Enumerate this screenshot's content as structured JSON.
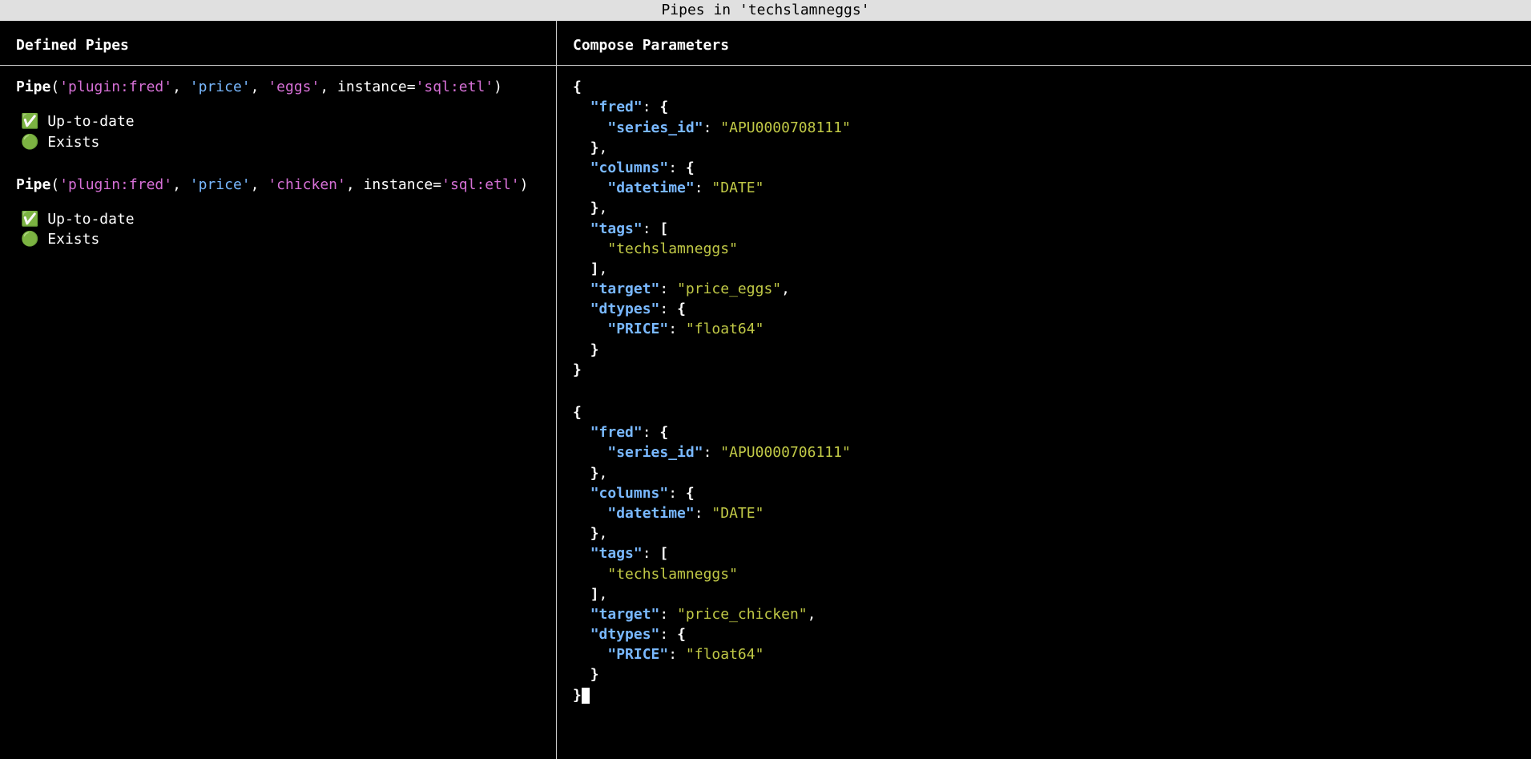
{
  "title": "Pipes in 'techslamneggs'",
  "left_header": "Defined Pipes",
  "right_header": "Compose Parameters",
  "pipes": [
    {
      "func": "Pipe",
      "args": [
        "'plugin:fred'",
        "'price'",
        "'eggs'"
      ],
      "kwarg_name": "instance",
      "kwarg_value": "'sql:etl'",
      "status": [
        {
          "icon": "✅",
          "label": "Up-to-date"
        },
        {
          "icon": "🟢",
          "label": "Exists"
        }
      ]
    },
    {
      "func": "Pipe",
      "args": [
        "'plugin:fred'",
        "'price'",
        "'chicken'"
      ],
      "kwarg_name": "instance",
      "kwarg_value": "'sql:etl'",
      "status": [
        {
          "icon": "✅",
          "label": "Up-to-date"
        },
        {
          "icon": "🟢",
          "label": "Exists"
        }
      ]
    }
  ],
  "compose": [
    {
      "fred": {
        "series_id": "APU0000708111"
      },
      "columns": {
        "datetime": "DATE"
      },
      "tags": [
        "techslamneggs"
      ],
      "target": "price_eggs",
      "dtypes": {
        "PRICE": "float64"
      }
    },
    {
      "fred": {
        "series_id": "APU0000706111"
      },
      "columns": {
        "datetime": "DATE"
      },
      "tags": [
        "techslamneggs"
      ],
      "target": "price_chicken",
      "dtypes": {
        "PRICE": "float64"
      }
    }
  ]
}
